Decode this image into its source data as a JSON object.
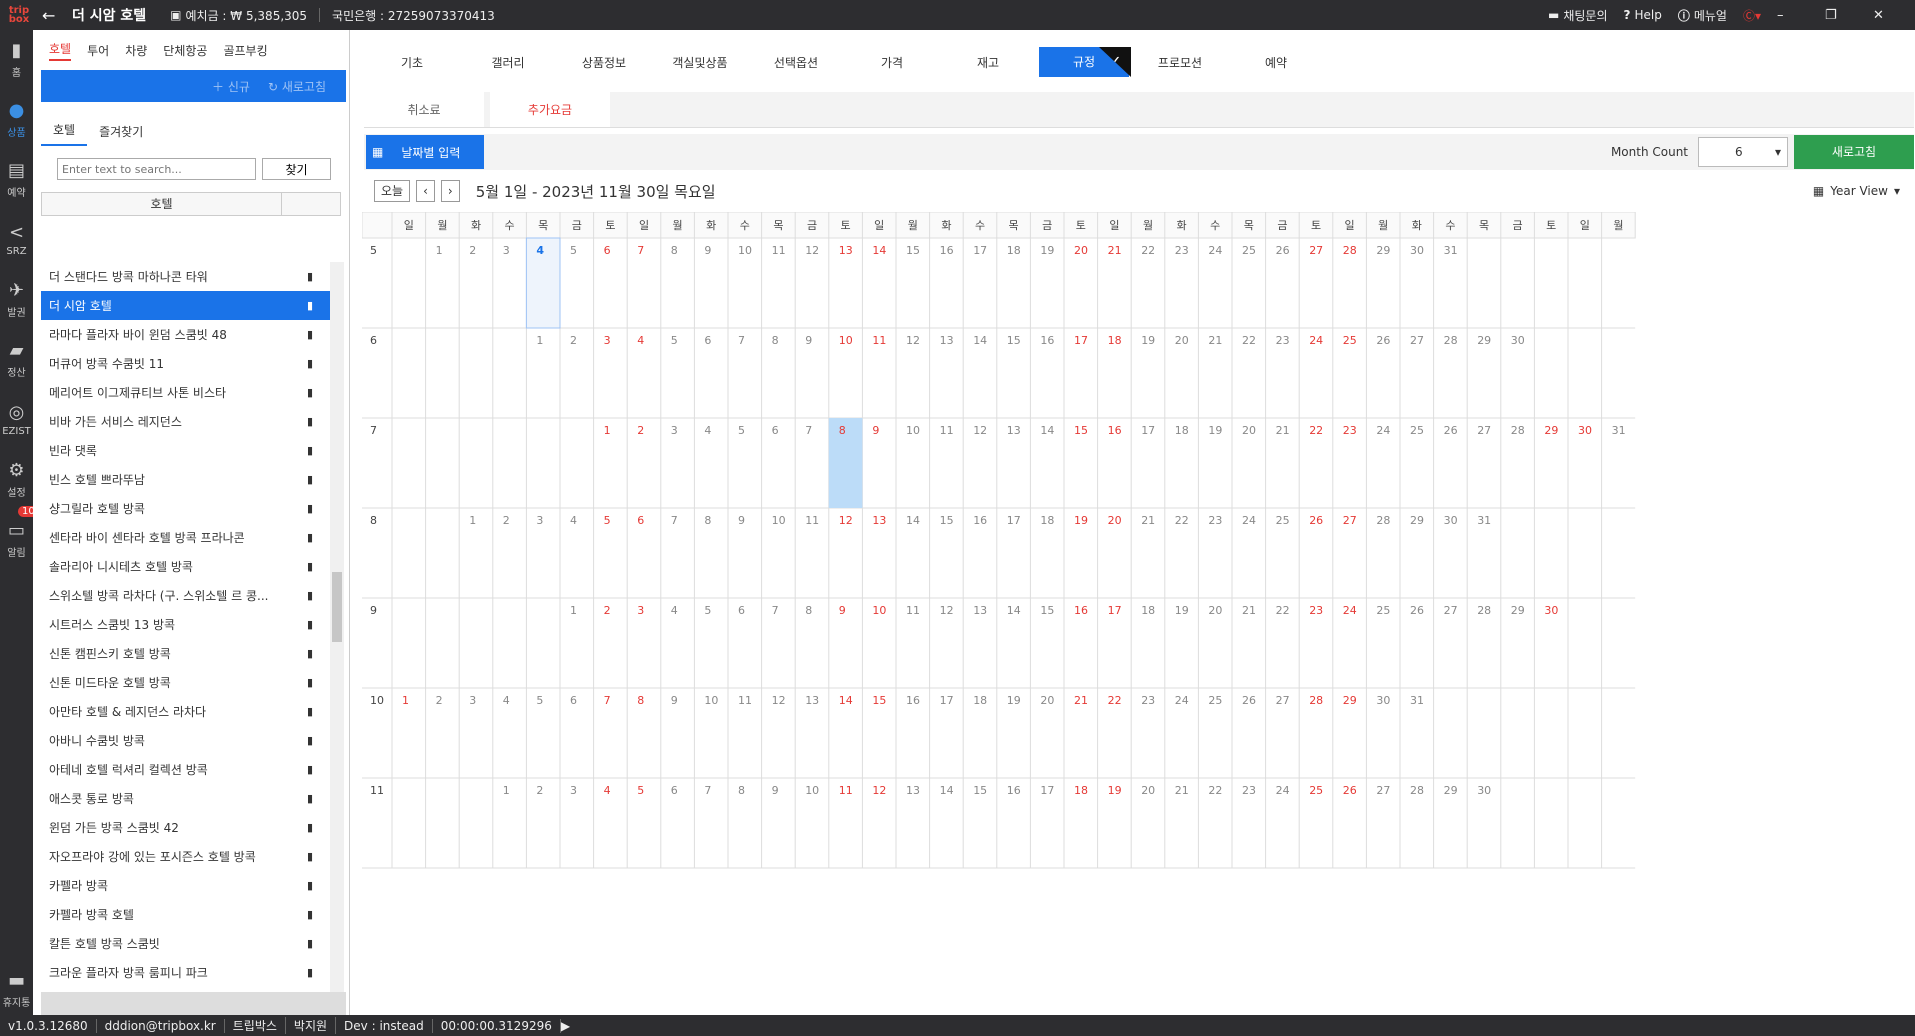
{
  "app": {
    "logo": "trip box",
    "title": "더 시암 호텔",
    "deposit": "예치금 : ₩ 5,385,305",
    "bank": "국민은행 : 27259073370413",
    "chat": "채팅문의",
    "help": "Help",
    "manual": "메뉴얼"
  },
  "rail": [
    {
      "label": "홈",
      "icon": "home-icon"
    },
    {
      "label": "상품",
      "icon": "globe-icon"
    },
    {
      "label": "예약",
      "icon": "booking-icon"
    },
    {
      "label": "SRZ",
      "icon": "share-icon"
    },
    {
      "label": "발권",
      "icon": "plane-icon"
    },
    {
      "label": "정산",
      "icon": "wallet-icon"
    },
    {
      "label": "EZIST",
      "icon": "web-icon"
    },
    {
      "label": "설정",
      "icon": "gear-icon"
    },
    {
      "label": "알림",
      "icon": "bell-icon",
      "badge": "10"
    }
  ],
  "rail_bottom": "휴지통",
  "categories": [
    "호텔",
    "투어",
    "차량",
    "단체항공",
    "골프부킹"
  ],
  "sidebar": {
    "new": "신규",
    "refresh": "새로고침",
    "sub_tabs": [
      "호텔",
      "즐겨찾기"
    ],
    "search_placeholder": "Enter text to search...",
    "search_button": "찾기",
    "column": "호텔"
  },
  "hotels": [
    "더 스탠다드 방콕 마하나콘 타워",
    "더 시암 호텔",
    "라마다 플라자 바이 윈덤 스쿰빗 48",
    "머큐어 방콕 수쿰빗 11",
    "메리어트 이그제큐티브 사톤 비스타",
    "비바 가든 서비스 레지던스",
    "빈라 댓록",
    "빈스 호텔 쁘라뚜남",
    "샹그릴라 호텔 방콕",
    "센타라 바이 센타라 호텔 방콕 프라나콘",
    "솔라리아 니시테츠 호텔 방콕",
    "스위소텔 방콕 라차다 (구. 스위소텔 르 콩...",
    "시트러스 스쿰빗 13 방콕",
    "신톤 캠핀스키 호텔 방콕",
    "신톤 미드타운 호텔 방콕",
    "아만타 호텔 & 레지던스 라차다",
    "아바니 수쿰빗 방콕",
    "아테네 호텔 럭셔리 컬렉션 방콕",
    "애스콧 통로 방콕",
    "윈덤 가든 방콕 스쿰빗 42",
    "자오프라야 강에 있는 포시즌스 호텔 방콕",
    "카펠라 방콕",
    "카펠라 방콕 호텔",
    "칼튼 호텔 방콕 스쿰빗",
    "크라운 플라자 방콕 룸피니 파크"
  ],
  "tabs": [
    "기초",
    "갤러리",
    "상품정보",
    "객실및상품",
    "선택옵션",
    "가격",
    "재고",
    "규정",
    "프로모션",
    "예약"
  ],
  "sub_tabs": [
    "취소료",
    "추가요금"
  ],
  "toolbar": {
    "date_input": "날짜별 입력",
    "month_count_label": "Month Count",
    "month_count": "6",
    "refresh": "새로고침"
  },
  "nav": {
    "today": "오늘",
    "range": "5월 1일 - 2023년 11월 30일 목요일",
    "view": "Year View"
  },
  "weekdays": [
    "일",
    "월",
    "화",
    "수",
    "목",
    "금",
    "토"
  ],
  "months": [
    {
      "m": "5",
      "start": 1,
      "days": 31
    },
    {
      "m": "6",
      "start": 4,
      "days": 30
    },
    {
      "m": "7",
      "start": 6,
      "days": 31
    },
    {
      "m": "8",
      "start": 2,
      "days": 31
    },
    {
      "m": "9",
      "start": 5,
      "days": 30
    },
    {
      "m": "10",
      "start": 0,
      "days": 31
    },
    {
      "m": "11",
      "start": 3,
      "days": 30
    }
  ],
  "status": {
    "version": "v1.0.3.12680",
    "user": "dddion@tripbox.kr",
    "company": "트립박스",
    "name": "박지원",
    "dev": "Dev : instead",
    "time": "00:00:00.3129296"
  },
  "colors": {
    "accent": "#1a73e8",
    "weekend": "#e53935",
    "green": "#2e9e4f",
    "dark": "#2d2d30"
  }
}
